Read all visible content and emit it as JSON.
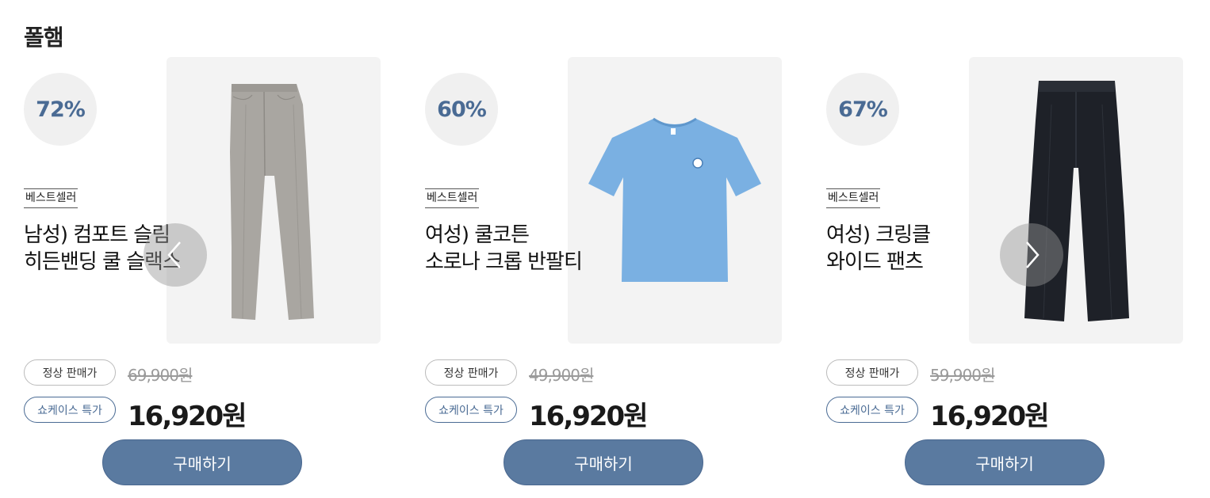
{
  "brand": "폴햄",
  "products": [
    {
      "discount": "72%",
      "badge": "베스트셀러",
      "title_line1": "남성) 컴포트 슬림",
      "title_line2": "히든밴딩 쿨 슬랙스",
      "regular_label": "정상 판매가",
      "regular_price": "69,900원",
      "showcase_label": "쇼케이스 특가",
      "sale_price": "16,920원",
      "buy_label": "구매하기"
    },
    {
      "discount": "60%",
      "badge": "베스트셀러",
      "title_line1": "여성) 쿨코튼",
      "title_line2": "소로나 크롭 반팔티",
      "regular_label": "정상 판매가",
      "regular_price": "49,900원",
      "showcase_label": "쇼케이스 특가",
      "sale_price": "16,920원",
      "buy_label": "구매하기"
    },
    {
      "discount": "67%",
      "badge": "베스트셀러",
      "title_line1": "여성) 크링클",
      "title_line2": "와이드 팬츠",
      "regular_label": "정상 판매가",
      "regular_price": "59,900원",
      "showcase_label": "쇼케이스 특가",
      "sale_price": "16,920원",
      "buy_label": "구매하기"
    }
  ],
  "icons": {
    "prev": "chevron-left-icon",
    "next": "chevron-right-icon"
  },
  "colors": {
    "accent": "#5a7aa0",
    "discount_text": "#4a6b94"
  }
}
